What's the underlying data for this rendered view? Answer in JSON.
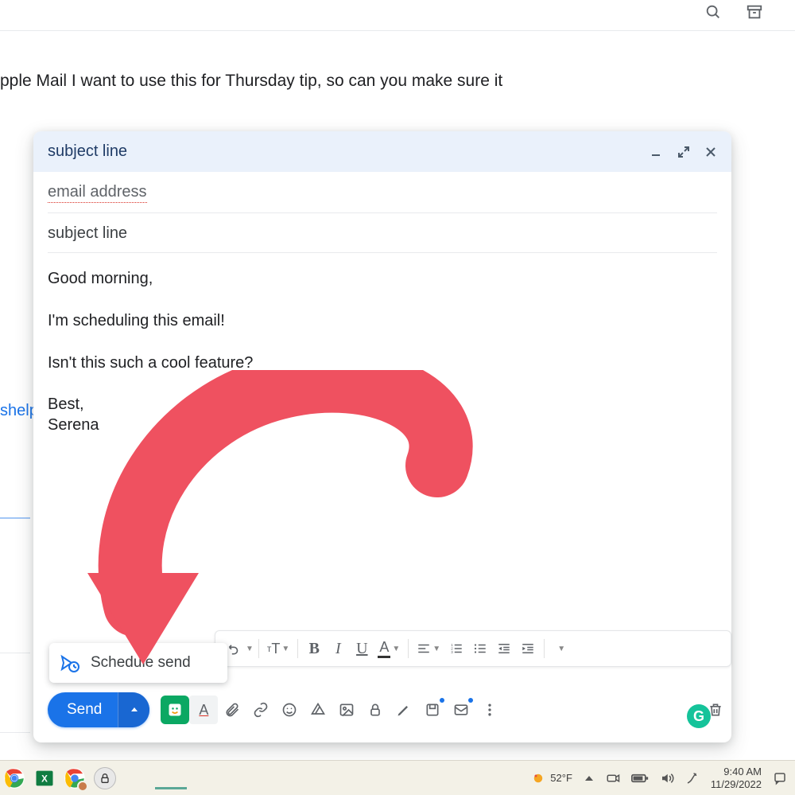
{
  "page": {
    "background_text": "pple Mail I want to use this for Thursday tip, so can you make sure it",
    "side_link": "shelp"
  },
  "top_icons": {
    "search": "search-icon",
    "archive": "archive-icon"
  },
  "compose": {
    "header_title": "subject line",
    "to_value": "email address",
    "subject_value": "subject line",
    "body": {
      "line1": "Good morning,",
      "line2": "I'm scheduling this email!",
      "line3": "Isn't this such a cool feature?",
      "sig1": "Best,",
      "sig2": "Serena"
    },
    "grammarly_letter": "G",
    "schedule_send_label": "Schedule send",
    "send_label": "Send",
    "format_toolbar": {
      "font_size": "tT",
      "bold": "B",
      "italic": "I",
      "underline": "U",
      "color": "A"
    }
  },
  "taskbar": {
    "weather_temp": "52°F",
    "time": "9:40 AM",
    "date": "11/29/2022"
  },
  "colors": {
    "accent": "#1a73e8",
    "arrow": "#ef5160",
    "grammarly": "#15c39a"
  }
}
